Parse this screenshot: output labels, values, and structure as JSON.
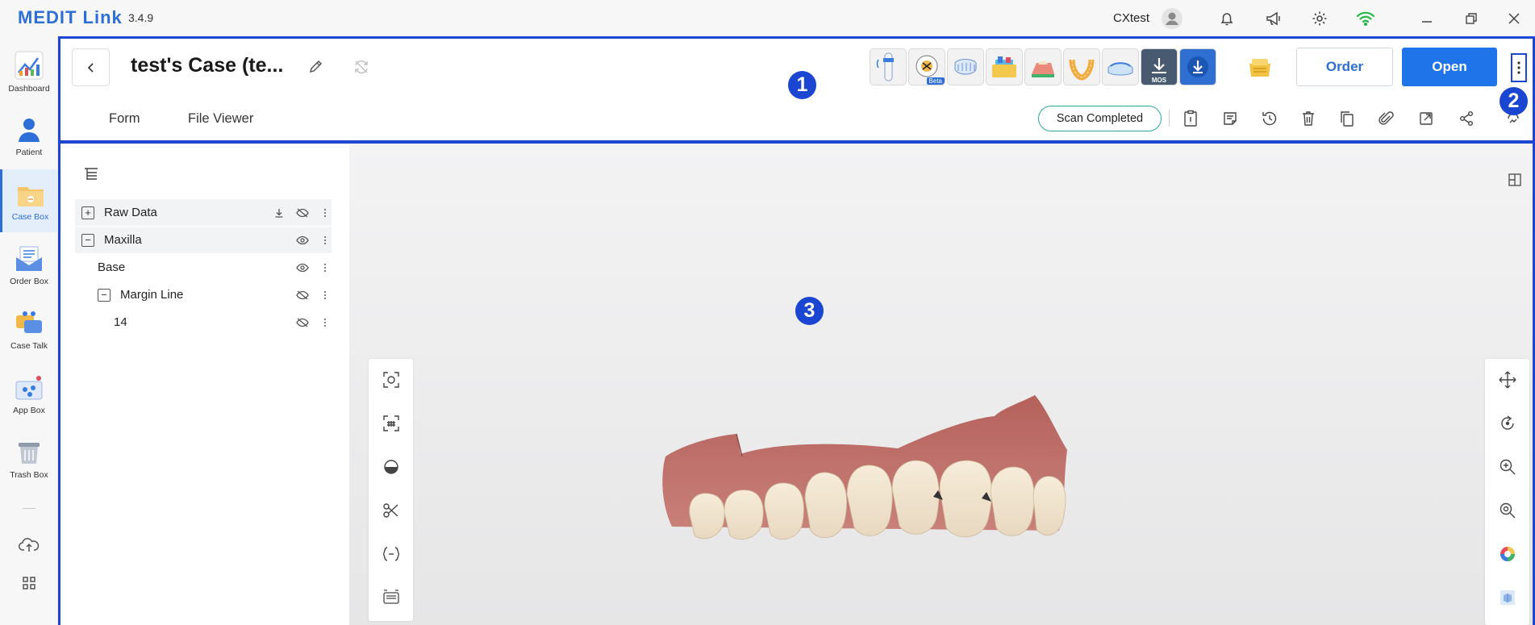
{
  "titlebar": {
    "brand": "MEDIT Link",
    "version": "3.4.9",
    "username": "CXtest",
    "icons": [
      "user-avatar-icon",
      "bell-icon",
      "megaphone-icon",
      "gear-icon",
      "wifi-icon",
      "minimize-icon",
      "restore-icon",
      "close-icon"
    ]
  },
  "sidebar": {
    "items": [
      {
        "label": "Dashboard",
        "icon": "dashboard-chart-icon"
      },
      {
        "label": "Patient",
        "icon": "patient-icon"
      },
      {
        "label": "Case Box",
        "icon": "case-box-icon"
      },
      {
        "label": "Order Box",
        "icon": "order-box-icon"
      },
      {
        "label": "Case Talk",
        "icon": "case-talk-icon"
      },
      {
        "label": "App Box",
        "icon": "app-box-icon"
      },
      {
        "label": "Trash Box",
        "icon": "trash-box-icon"
      }
    ],
    "bottom_icons": [
      "cloud-upload-icon",
      "grid-apps-icon"
    ]
  },
  "case": {
    "title": "test's Case (te...",
    "order_label": "Order",
    "open_label": "Open",
    "beta_label": "Beta",
    "mos_label": "MOS",
    "apps": [
      "scan-app-icon",
      "ortho-beta-app-icon",
      "crown-app-icon",
      "clinic-app-icon",
      "model-app-icon",
      "splint-app-icon",
      "guard-app-icon",
      "mos-download-app-icon",
      "download-app-icon"
    ]
  },
  "tabs": [
    {
      "label": "Form"
    },
    {
      "label": "File Viewer"
    }
  ],
  "status": {
    "label": "Scan Completed",
    "color": "#2aa89c"
  },
  "badges": {
    "one": "1",
    "two": "2",
    "three": "3",
    "color": "#1b46d1"
  },
  "tree": {
    "rows": [
      {
        "label": "Raw Data",
        "expander": "+"
      },
      {
        "label": "Maxilla",
        "expander": "−"
      },
      {
        "label": "Base",
        "expander": ""
      },
      {
        "label": "Margin Line",
        "expander": "−"
      },
      {
        "label": "14",
        "expander": ""
      }
    ]
  },
  "colors": {
    "accent": "#2d6fd6",
    "highlight": "#1b46d1",
    "open_button": "#1f74ea"
  }
}
